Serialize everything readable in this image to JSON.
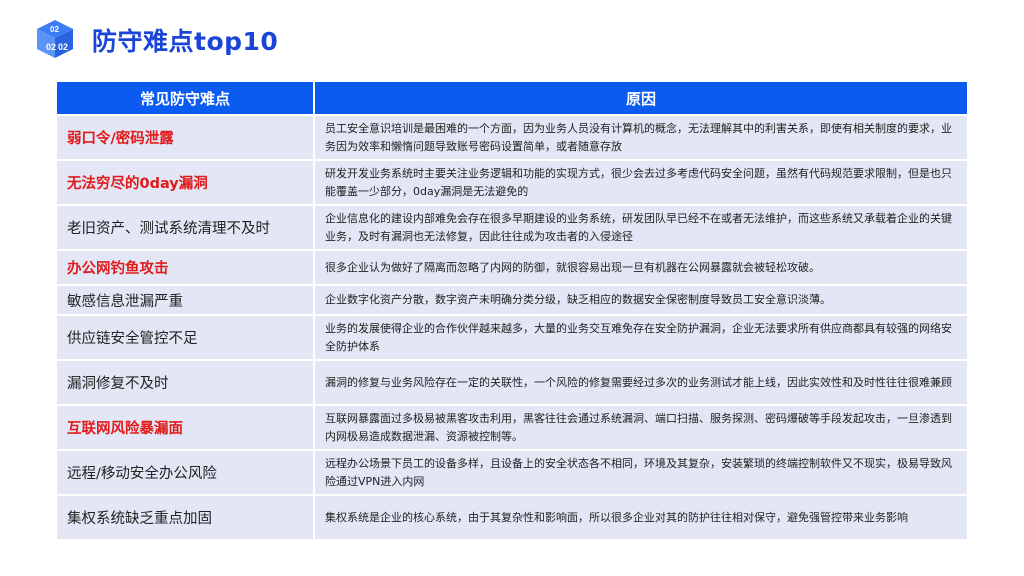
{
  "header": {
    "logo_text": "02",
    "title": "防守难点top10"
  },
  "table": {
    "headers": [
      "常见防守难点",
      "原因"
    ],
    "rows": [
      {
        "issue": "弱口令/密码泄露",
        "highlight": true,
        "reason": "员工安全意识培训是最困难的一个方面，因为业务人员没有计算机的概念，无法理解其中的利害关系，即使有相关制度的要求，业务因为效率和懒惰问题导致账号密码设置简单，或者随意存放"
      },
      {
        "issue": "无法穷尽的0day漏洞",
        "highlight": true,
        "reason": "研发开发业务系统时主要关注业务逻辑和功能的实现方式，很少会去过多考虑代码安全问题，虽然有代码规范要求限制，但是也只能覆盖一少部分，0day漏洞是无法避免的"
      },
      {
        "issue": "老旧资产、测试系统清理不及时",
        "highlight": false,
        "reason": "企业信息化的建设内部难免会存在很多早期建设的业务系统，研发团队早已经不在或者无法维护，而这些系统又承载着企业的关键业务，及时有漏洞也无法修复，因此往往成为攻击者的入侵途径"
      },
      {
        "issue": "办公网钓鱼攻击",
        "highlight": true,
        "reason": "很多企业认为做好了隔离而忽略了内网的防御，就很容易出现一旦有机器在公网暴露就会被轻松攻破。"
      },
      {
        "issue": "敏感信息泄漏严重",
        "highlight": false,
        "reason": "企业数字化资产分散，数字资产未明确分类分级，缺乏相应的数据安全保密制度导致员工安全意识淡薄。"
      },
      {
        "issue": "供应链安全管控不足",
        "highlight": false,
        "reason": "业务的发展使得企业的合作伙伴越来越多，大量的业务交互难免存在安全防护漏洞，企业无法要求所有供应商都具有较强的网络安全防护体系"
      },
      {
        "issue": "漏洞修复不及时",
        "highlight": false,
        "reason": "漏洞的修复与业务风险存在一定的关联性，一个风险的修复需要经过多次的业务测试才能上线，因此实效性和及时性往往很难兼顾"
      },
      {
        "issue": "互联网风险暴漏面",
        "highlight": true,
        "reason": "互联网暴露面过多极易被黑客攻击利用，黑客往往会通过系统漏洞、端口扫描、服务探测、密码爆破等手段发起攻击，一旦渗透到内网极易造成数据泄漏、资源被控制等。"
      },
      {
        "issue": "远程/移动安全办公风险",
        "highlight": false,
        "reason": "远程办公场景下员工的设备多样，且设备上的安全状态各不相同，环境及其复杂，安装繁琐的终端控制软件又不现实，极易导致风险通过VPN进入内网"
      },
      {
        "issue": "集权系统缺乏重点加固",
        "highlight": false,
        "reason": "集权系统是企业的核心系统，由于其复杂性和影响面，所以很多企业对其的防护往往相对保守，避免强管控带来业务影响"
      }
    ]
  },
  "colors": {
    "title": "#1a45d8",
    "header_bg": "#0b5bf0",
    "row_bg": "#e3e6f5",
    "highlight_text": "#e01b1b"
  }
}
